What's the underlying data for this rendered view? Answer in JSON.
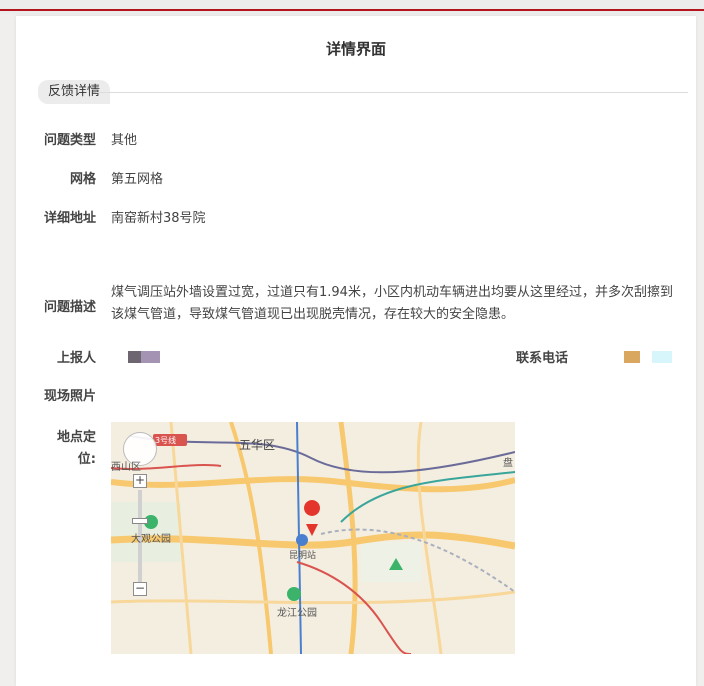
{
  "page": {
    "title": "详情界面"
  },
  "section": {
    "tab_label": "反馈详情"
  },
  "fields": {
    "type_label": "问题类型",
    "type_value": "其他",
    "grid_label": "网格",
    "grid_value": "第五网格",
    "address_label": "详细地址",
    "address_value": "南窑新村38号院",
    "desc_label": "问题描述",
    "desc_value": "煤气调压站外墙设置过宽，过道只有1.94米，小区内机动车辆进出均要从这里经过，并多次刮擦到该煤气管道，导致煤气管道现已出现脱壳情况，存在较大的安全隐患。",
    "reporter_label": "上报人",
    "phone_label": "联系电话",
    "photo_label": "现场照片",
    "location_label_line1": "地点定",
    "location_label_line2": "位:"
  },
  "map": {
    "district": "五华区",
    "district2": "西山区",
    "park1": "大观公园",
    "park2": "龙江公园",
    "station": "昆明站",
    "badge": "3号线",
    "partial": "盘",
    "zoom_in": "+",
    "zoom_out": "−",
    "colors": {
      "road": "#f7c86e",
      "metro_teal": "#3aa59a",
      "metro_red": "#d9534f",
      "metro_blue": "#4a7fd0",
      "marker": "#e3352b",
      "park": "#3bb36a"
    }
  }
}
